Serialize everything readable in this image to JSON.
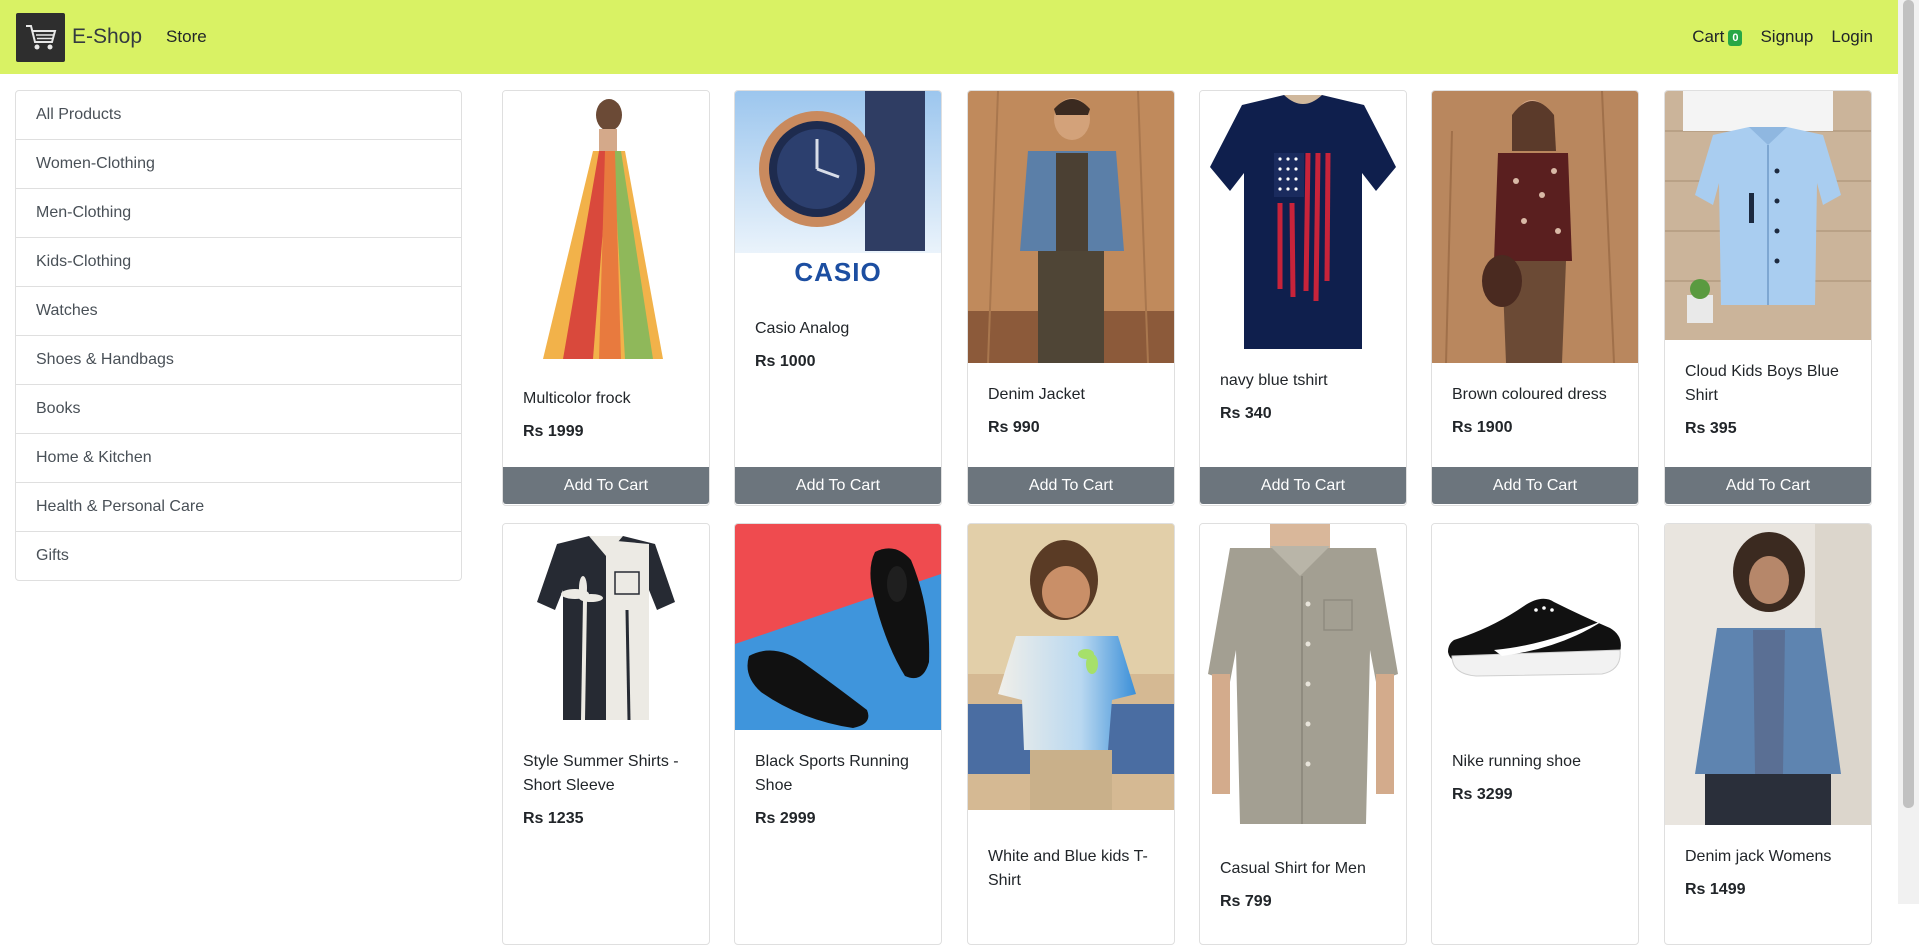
{
  "navbar": {
    "brand": "E-Shop",
    "store_label": "Store",
    "cart_label": "Cart",
    "cart_count": "0",
    "signup_label": "Signup",
    "login_label": "Login"
  },
  "sidebar": {
    "items": [
      {
        "label": "All Products"
      },
      {
        "label": "Women-Clothing"
      },
      {
        "label": "Men-Clothing"
      },
      {
        "label": "Kids-Clothing"
      },
      {
        "label": "Watches"
      },
      {
        "label": "Shoes & Handbags"
      },
      {
        "label": "Books"
      },
      {
        "label": "Home & Kitchen"
      },
      {
        "label": "Health & Personal Care"
      },
      {
        "label": "Gifts"
      }
    ]
  },
  "products": [
    {
      "name": "Multicolor frock",
      "price": "Rs 1999",
      "button": "Add To Cart"
    },
    {
      "name": "Casio Analog",
      "price": "Rs 1000",
      "button": "Add To Cart",
      "logo_text": "CASIO"
    },
    {
      "name": "Denim Jacket",
      "price": "Rs 990",
      "button": "Add To Cart"
    },
    {
      "name": "navy blue tshirt",
      "price": "Rs 340",
      "button": "Add To Cart"
    },
    {
      "name": "Brown coloured dress",
      "price": "Rs 1900",
      "button": "Add To Cart"
    },
    {
      "name": "Cloud Kids Boys Blue Shirt",
      "price": "Rs 395",
      "button": "Add To Cart"
    },
    {
      "name": "Style Summer Shirts - Short Sleeve",
      "price": "Rs 1235"
    },
    {
      "name": "Black Sports Running Shoe",
      "price": "Rs 2999"
    },
    {
      "name": "White and Blue kids T-Shirt",
      "price": ""
    },
    {
      "name": "Casual Shirt for Men",
      "price": "Rs 799"
    },
    {
      "name": "Nike running shoe",
      "price": "Rs 3299"
    },
    {
      "name": "Denim jack Womens",
      "price": "Rs 1499"
    }
  ],
  "colors": {
    "navbar_bg": "#d9f264",
    "button_bg": "#6c757d",
    "badge_bg": "#28a745"
  }
}
